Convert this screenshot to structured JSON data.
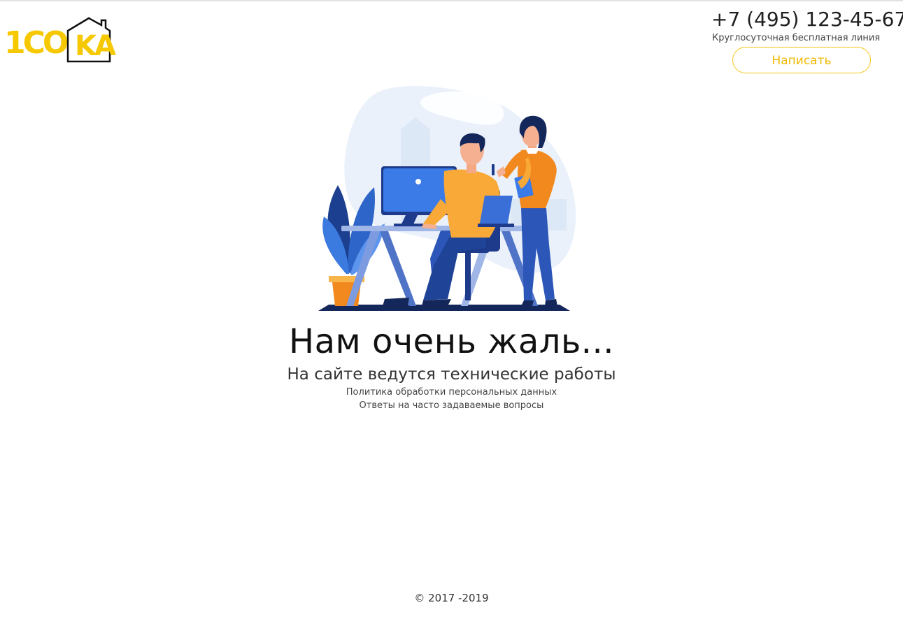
{
  "header": {
    "logo": {
      "text_left": "1CO",
      "text_right": "KA",
      "colors": {
        "accent": "#f5c800",
        "outline": "#111111"
      }
    },
    "contacts": {
      "phone": "+7 (495) 123-45-67",
      "phone_note": "Круглосуточная бесплатная линия",
      "write_button": "Написать"
    }
  },
  "main": {
    "illustration": "office-workers-illustration",
    "headline": "Нам очень жаль...",
    "subline": "На сайте ведутся технические работы",
    "links": {
      "privacy_policy": "Политика обработки персональных данных",
      "faq": "Ответы на часто задаваемые вопросы"
    }
  },
  "footer": {
    "copyright": "© 2017 -2019"
  },
  "colors": {
    "accent": "#f5c518",
    "text": "#222222",
    "background": "#ffffff"
  }
}
